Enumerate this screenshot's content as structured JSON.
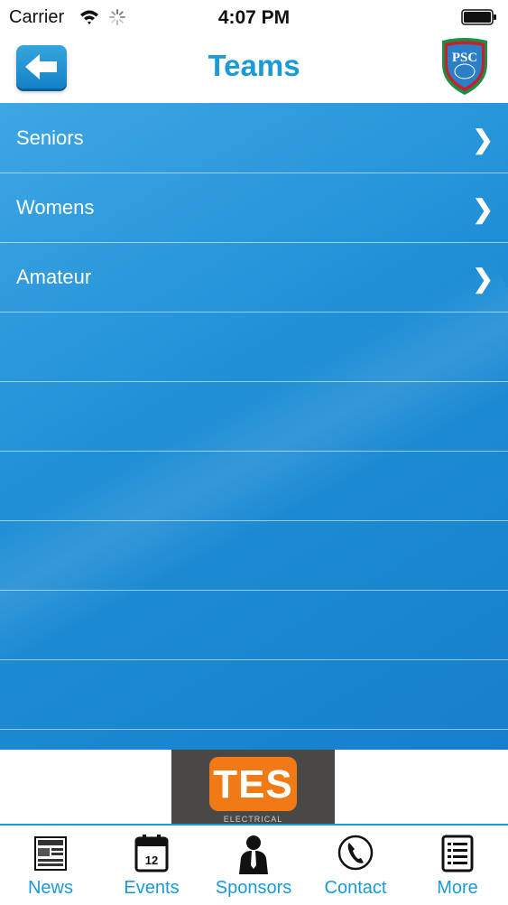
{
  "status_bar": {
    "carrier": "Carrier",
    "time": "4:07 PM"
  },
  "nav": {
    "title": "Teams",
    "back_icon": "arrow-left-icon",
    "logo_icon": "club-crest-icon",
    "logo_text": "PSC"
  },
  "teams": [
    {
      "label": "Seniors",
      "chevron": "❯"
    },
    {
      "label": "Womens",
      "chevron": "❯"
    },
    {
      "label": "Amateur",
      "chevron": "❯"
    }
  ],
  "ad": {
    "brand": "TES",
    "subtitle": "ELECTRICAL"
  },
  "tabs": [
    {
      "label": "News",
      "icon": "newspaper-icon"
    },
    {
      "label": "Events",
      "icon": "calendar-icon",
      "icon_text": "12"
    },
    {
      "label": "Sponsors",
      "icon": "person-icon"
    },
    {
      "label": "Contact",
      "icon": "phone-icon"
    },
    {
      "label": "More",
      "icon": "list-icon"
    }
  ],
  "colors": {
    "accent": "#1a9ad6",
    "list_bg": "#1f8fd6",
    "ad_orange": "#f07b16"
  }
}
